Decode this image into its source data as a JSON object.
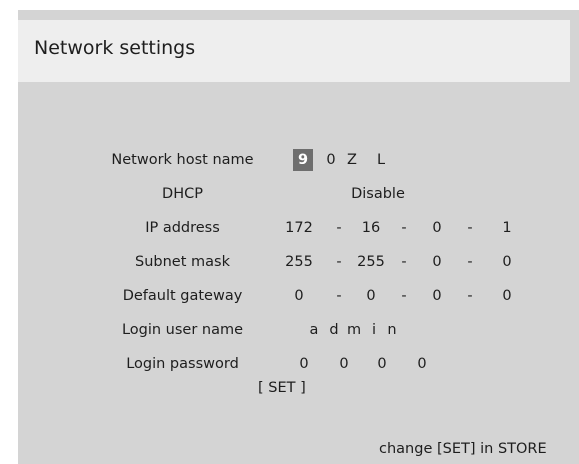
{
  "title": "Network settings",
  "rows": {
    "host_name": {
      "label": "Network host name",
      "chars": [
        "9",
        "0",
        "Z",
        "L"
      ]
    },
    "dhcp": {
      "label": "DHCP",
      "value": "Disable"
    },
    "ip": {
      "label": "IP address",
      "octets": [
        "172",
        "16",
        "0",
        "1"
      ]
    },
    "subnet": {
      "label": "Subnet mask",
      "octets": [
        "255",
        "255",
        "0",
        "0"
      ]
    },
    "gateway": {
      "label": "Default gateway",
      "octets": [
        "0",
        "0",
        "0",
        "0"
      ]
    },
    "user": {
      "label": "Login user name",
      "chars": [
        "a",
        "d",
        "m",
        "i",
        "n"
      ]
    },
    "password": {
      "label": "Login password",
      "chars": [
        "0",
        "0",
        "0",
        "0"
      ]
    }
  },
  "separator": "-",
  "set_label": "[ SET ]",
  "footer": "change [SET] in STORE",
  "colors": {
    "panel_bg": "#d4d4d4",
    "title_bg": "#eeeeee",
    "highlight_bg": "#6e6e6e"
  }
}
